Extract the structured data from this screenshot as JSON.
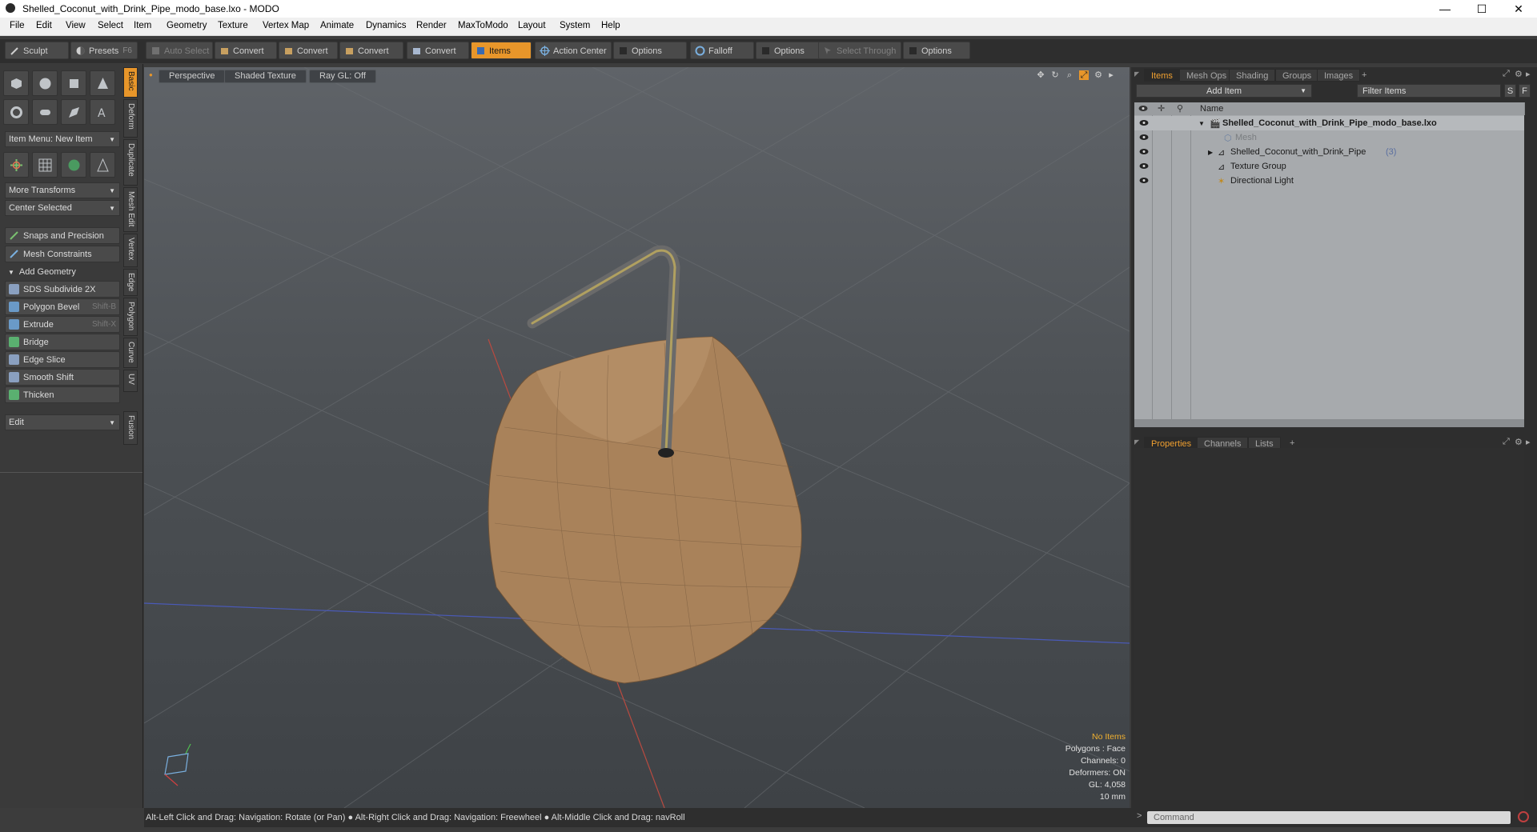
{
  "window": {
    "title": "Shelled_Coconut_with_Drink_Pipe_modo_base.lxo - MODO",
    "controls": [
      "—",
      "☐",
      "✕"
    ]
  },
  "menu": [
    "File",
    "Edit",
    "View",
    "Select",
    "Item",
    "Geometry",
    "Texture",
    "Vertex Map",
    "Animate",
    "Dynamics",
    "Render",
    "MaxToModo",
    "Layout",
    "System",
    "Help"
  ],
  "toolbar": {
    "sculpt": "Sculpt",
    "presets": "Presets",
    "presets_hotkey": "F6",
    "auto_select": "Auto Select",
    "convert1": "Convert",
    "convert2": "Convert",
    "convert3": "Convert",
    "convert4": "Convert",
    "items": "Items",
    "action_center": "Action Center",
    "options1": "Options",
    "falloff": "Falloff",
    "options2": "Options",
    "select_through": "Select Through",
    "options3": "Options"
  },
  "left_panel": {
    "item_menu": "Item Menu: New Item",
    "more_transforms": "More Transforms",
    "center_selected": "Center Selected",
    "snaps": "Snaps and Precision",
    "mesh_constraints": "Mesh Constraints",
    "add_geometry": "Add Geometry",
    "tools": [
      {
        "label": "SDS Subdivide 2X",
        "hotkey": ""
      },
      {
        "label": "Polygon Bevel",
        "hotkey": "Shift-B"
      },
      {
        "label": "Extrude",
        "hotkey": "Shift-X"
      },
      {
        "label": "Bridge",
        "hotkey": ""
      },
      {
        "label": "Edge Slice",
        "hotkey": ""
      },
      {
        "label": "Smooth Shift",
        "hotkey": ""
      },
      {
        "label": "Thicken",
        "hotkey": ""
      }
    ],
    "edit": "Edit",
    "vtabs": [
      "Basic",
      "Deform",
      "Duplicate",
      "Mesh Edit",
      "Vertex",
      "Edge",
      "Polygon",
      "Curve",
      "UV",
      "Fusion"
    ]
  },
  "viewport": {
    "view": "Perspective",
    "shading": "Shaded Texture",
    "raygl": "Ray GL: Off",
    "stats": {
      "selection": "No Items",
      "polygons": "Polygons : Face",
      "channels": "Channels: 0",
      "deformers": "Deformers: ON",
      "gl": "GL: 4,058",
      "scale": "10 mm"
    }
  },
  "status_bar": {
    "hint": "Alt-Left Click and Drag: Navigation: Rotate (or Pan) ● Alt-Right Click and Drag: Navigation: Freewheel ● Alt-Middle Click and Drag: navRoll"
  },
  "items_panel": {
    "tabs": [
      "Items",
      "Mesh Ops",
      "Shading",
      "Groups",
      "Images",
      "+"
    ],
    "add_item": "Add Item",
    "filter_placeholder": "Filter Items",
    "filter_s": "S",
    "filter_f": "F",
    "col_name": "Name",
    "rows": [
      {
        "label": "Shelled_Coconut_with_Drink_Pipe_modo_base.lxo",
        "count": ""
      },
      {
        "label": "Mesh",
        "count": ""
      },
      {
        "label": "Shelled_Coconut_with_Drink_Pipe",
        "count": "(3)"
      },
      {
        "label": "Texture Group",
        "count": ""
      },
      {
        "label": "Directional Light",
        "count": ""
      }
    ]
  },
  "properties_panel": {
    "tabs": [
      "Properties",
      "Channels",
      "Lists",
      "+"
    ]
  },
  "command": {
    "placeholder": "Command",
    "prompt": ">"
  },
  "colors": {
    "accent": "#e8962a",
    "panel": "#3a3a3a",
    "list_bg": "#a7aaad"
  }
}
